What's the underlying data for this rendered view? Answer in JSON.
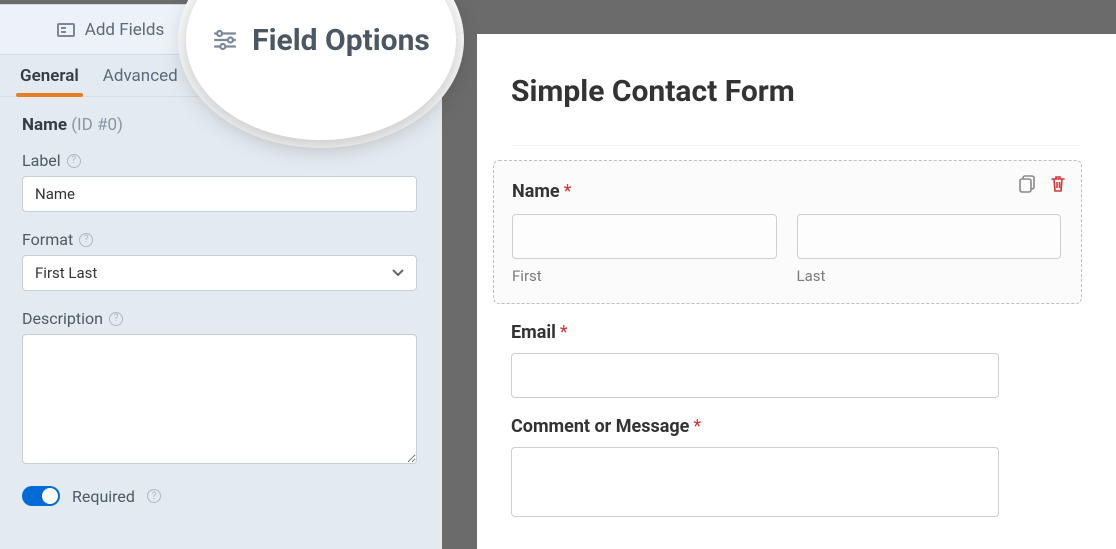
{
  "topTabs": {
    "addFields": "Add Fields",
    "fieldOptions": "Field Options"
  },
  "subTabs": {
    "general": "General",
    "advanced": "Advanced"
  },
  "fieldHeader": {
    "name": "Name",
    "id": "(ID #0)"
  },
  "labels": {
    "label": "Label",
    "format": "Format",
    "description": "Description",
    "required": "Required"
  },
  "inputs": {
    "labelValue": "Name",
    "formatValue": "First Last",
    "descriptionValue": ""
  },
  "magnify": {
    "title": "Field Options"
  },
  "preview": {
    "formTitle": "Simple Contact Form",
    "nameLabel": "Name",
    "firstSub": "First",
    "lastSub": "Last",
    "emailLabel": "Email",
    "commentLabel": "Comment or Message",
    "star": "*"
  }
}
